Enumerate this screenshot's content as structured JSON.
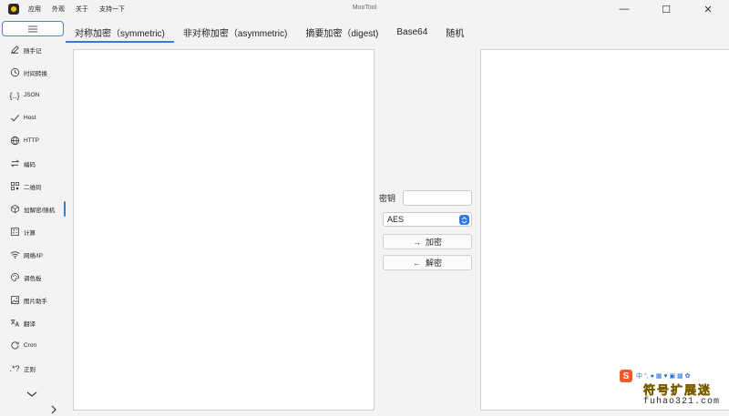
{
  "window": {
    "title": "MooTool",
    "menu": [
      "应用",
      "外观",
      "关于",
      "支持一下"
    ],
    "controls": {
      "minimize": "—",
      "maximize": "☐",
      "close": "✕"
    }
  },
  "sidebar": {
    "items": [
      {
        "label": "随手记",
        "icon": "pen-icon"
      },
      {
        "label": "时间转换",
        "icon": "clock-icon"
      },
      {
        "label": "JSON",
        "icon": "braces-icon"
      },
      {
        "label": "Host",
        "icon": "check-icon"
      },
      {
        "label": "HTTP",
        "icon": "globe-icon"
      },
      {
        "label": "编码",
        "icon": "swap-icon"
      },
      {
        "label": "二维码",
        "icon": "qrcode-icon"
      },
      {
        "label": "加解密/随机",
        "icon": "cube-icon",
        "active": true
      },
      {
        "label": "计算",
        "icon": "calc-icon"
      },
      {
        "label": "网络/IP",
        "icon": "wifi-icon"
      },
      {
        "label": "调色板",
        "icon": "palette-icon"
      },
      {
        "label": "图片助手",
        "icon": "image-icon"
      },
      {
        "label": "翻译",
        "icon": "translate-icon"
      },
      {
        "label": "Cron",
        "icon": "cron-icon"
      },
      {
        "label": "正则",
        "icon": "regex-icon"
      }
    ]
  },
  "tabs": [
    {
      "label": "对称加密（symmetric)",
      "active": true
    },
    {
      "label": "非对称加密（asymmetric)"
    },
    {
      "label": "摘要加密（digest)"
    },
    {
      "label": "Base64"
    },
    {
      "label": "随机"
    }
  ],
  "crypto": {
    "key_label": "密钥",
    "key_value": "",
    "algorithm": "AES",
    "encrypt_label": "加密",
    "decrypt_label": "解密",
    "input_text": "",
    "output_text": ""
  },
  "watermark": {
    "badge": "S",
    "toolbar": "中 °, ● ▦ ♥ ▣ ▦ ✿",
    "name": "符号扩展迷",
    "url": "fuhao321.com"
  },
  "colors": {
    "accent": "#3a7bd5",
    "select_chevron": "#2f7be6"
  }
}
